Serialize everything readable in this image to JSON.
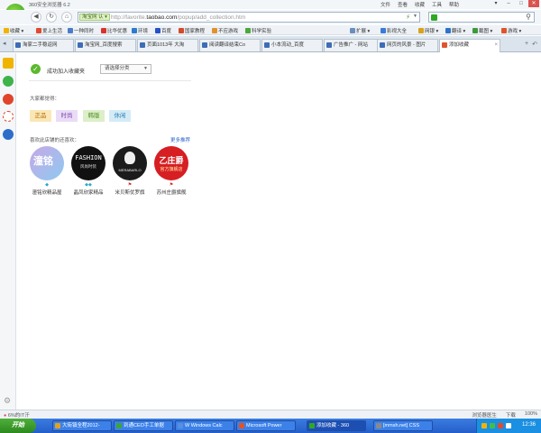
{
  "window": {
    "title": "360安全浏览器 6.2",
    "menu": [
      "文件",
      "查看",
      "收藏",
      "工具",
      "帮助"
    ],
    "controls": [
      "▾",
      "–",
      "□",
      "✕"
    ]
  },
  "address": {
    "site_tag": "淘宝网",
    "site_tag_icon": "认",
    "url_prefix": "http://favorite.",
    "url_domain": "taobao.com",
    "url_suffix": "/popup/add_collection.htm",
    "search_value": ""
  },
  "bookmarks": [
    {
      "label": "收藏",
      "icon_color": "#f0b400",
      "arrow": true
    },
    {
      "label": "爱上生活",
      "icon_color": "#e04a2e",
      "arrow": false
    },
    {
      "label": "一种同时",
      "icon_color": "#4a7dc8",
      "arrow": false
    },
    {
      "label": "比华优惠",
      "icon_color": "#d8342b",
      "arrow": false
    },
    {
      "label": "环境",
      "icon_color": "#2f7bd0",
      "arrow": false
    },
    {
      "label": "百度",
      "icon_color": "#2451c7",
      "arrow": false
    },
    {
      "label": "国家教程",
      "icon_color": "#d24b2b",
      "arrow": false
    },
    {
      "label": "不应游戏",
      "icon_color": "#e2922b",
      "arrow": false
    },
    {
      "label": "科学实验",
      "icon_color": "#4aa83d",
      "arrow": false
    }
  ],
  "bookmarks_right": [
    "扩展",
    "影视大全",
    "网银",
    "翻译",
    "截图",
    "游戏"
  ],
  "tabs": [
    {
      "label": "淘家二手稳返网",
      "active": false
    },
    {
      "label": "淘宝网_百度搜索",
      "active": false
    },
    {
      "label": "页面1013年 大淘",
      "active": false
    },
    {
      "label": "阅读翻译结束Co",
      "active": false
    },
    {
      "label": "小本流动_百度",
      "active": false
    },
    {
      "label": "广告推广 - 网站",
      "active": false
    },
    {
      "label": "网页的风景 - 图片",
      "active": false
    },
    {
      "label": "添加收藏",
      "active": true
    }
  ],
  "main": {
    "success_message": "成功加入收藏夹",
    "category_select": "请选择分类",
    "everyone_label": "大家都觉得：",
    "tags": [
      {
        "label": "正品",
        "bg": "#fbe7b5",
        "fg": "#b06a00"
      },
      {
        "label": "时尚",
        "bg": "#eadcf7",
        "fg": "#7a47a8"
      },
      {
        "label": "韩版",
        "bg": "#dcefc8",
        "fg": "#4b8a1f"
      },
      {
        "label": "休闲",
        "bg": "#d4ebf7",
        "fg": "#2c7fb0"
      }
    ],
    "similar_label": "喜欢此店铺的还喜欢：",
    "more_link": "更多推荐",
    "shops": [
      {
        "name": "潼铭欣精品屋",
        "logo_text": "潼铭",
        "badge": "◆"
      },
      {
        "name": "晶凤欣家精品",
        "logo_text": "FASHION",
        "logo_sub": "风尚时装",
        "badge": "◆◆"
      },
      {
        "name": "米贝斯优罗旗",
        "logo_text": "MERABARLO",
        "badge": "⚑"
      },
      {
        "name": "苏州庄爵旗舰",
        "logo_text": "乙庄爵",
        "logo_sub": "官方旗舰店",
        "badge": "⚑"
      }
    ]
  },
  "status": {
    "left": "6%的IT汗",
    "right": [
      "浏览器医生",
      "下载",
      "100%"
    ]
  },
  "taskbar": {
    "start": "开始",
    "tasks": [
      {
        "label": "大街镇全程2012-",
        "icon_color": "#e3a11e",
        "active": false
      },
      {
        "label": "到通CEO手工单据",
        "icon_color": "#3fa33a",
        "active": false
      },
      {
        "label": "W Windows Calc",
        "icon_color": "#5a8fe0",
        "active": false
      },
      {
        "label": "Microsoft Power",
        "icon_color": "#e0532a",
        "active": false
      },
      {
        "label": "添加收藏 - 360",
        "icon_color": "#2fa824",
        "active": true
      },
      {
        "label": "[mmsh.net] CSS",
        "icon_color": "#8a8a8a",
        "active": false
      }
    ],
    "clock": "12:36"
  }
}
